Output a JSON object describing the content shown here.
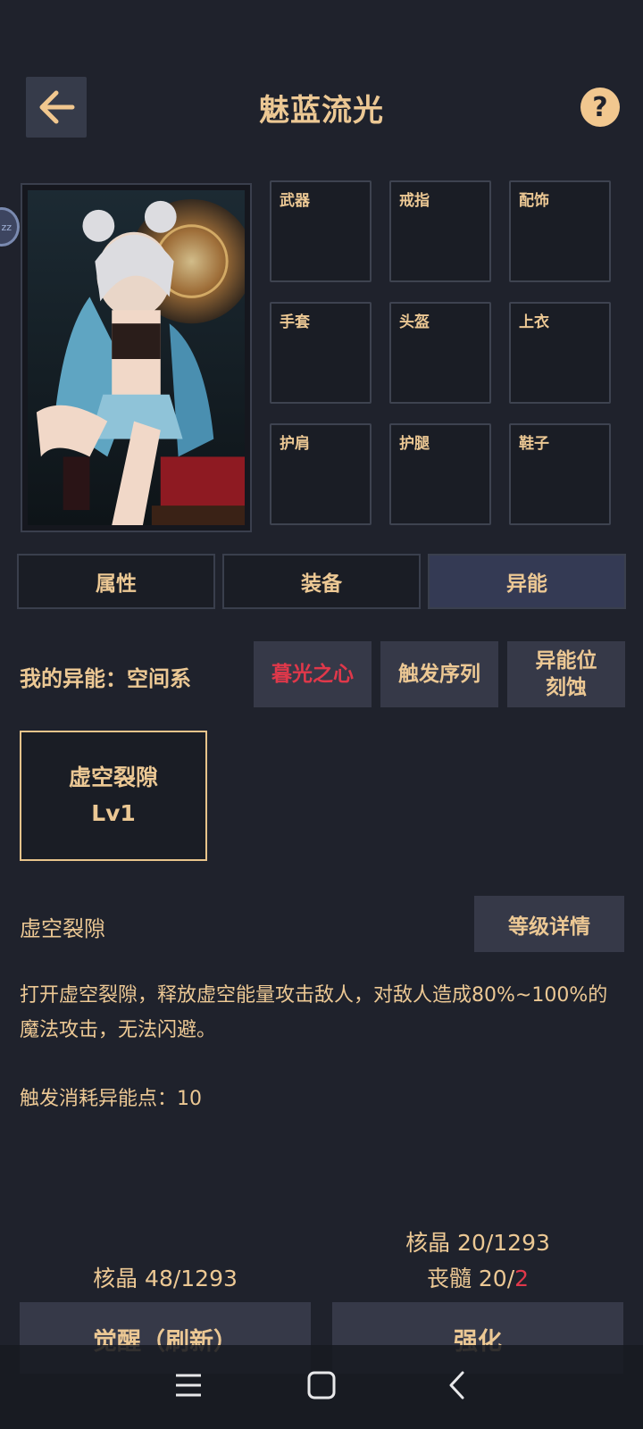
{
  "header": {
    "title": "魅蓝流光",
    "help_label": "?",
    "side_bubble_text": "zz"
  },
  "equipment": {
    "slots": [
      {
        "label": "武器"
      },
      {
        "label": "戒指"
      },
      {
        "label": "配饰"
      },
      {
        "label": "手套"
      },
      {
        "label": "头盔"
      },
      {
        "label": "上衣"
      },
      {
        "label": "护肩"
      },
      {
        "label": "护腿"
      },
      {
        "label": "鞋子"
      }
    ]
  },
  "tabs": [
    {
      "label": "属性",
      "active": false
    },
    {
      "label": "装备",
      "active": false
    },
    {
      "label": "异能",
      "active": true
    }
  ],
  "ability": {
    "my_ability_label": "我的异能：空间系",
    "buttons": [
      {
        "label": "暮光之心"
      },
      {
        "label": "触发序列"
      },
      {
        "label": "异能位\n刻蚀"
      }
    ],
    "skill_card": {
      "name": "虚空裂隙",
      "level": "Lv1"
    },
    "skill_title": "虚空裂隙",
    "level_detail_button": "等级详情",
    "description": "打开虚空裂隙，释放虚空能量攻击敌人，对敌人造成80%~100%的魔法攻击，无法闪避。",
    "trigger_cost": "触发消耗异能点：10"
  },
  "bottom": {
    "left_cost": "核晶 48/1293",
    "right_cost_line1": "核晶 20/1293",
    "right_cost_line2_prefix": "丧髓 20/",
    "right_cost_line2_value": "2",
    "awaken_button": "觉醒（刷新）",
    "enhance_button": "强化"
  },
  "colors": {
    "background": "#1f222c",
    "accent_text": "#ecc894",
    "warning_red": "#e0384a",
    "active_tab": "#343a54",
    "button_bg": "#363948"
  },
  "icons": {
    "back": "arrow-left-icon",
    "help": "question-icon",
    "nav_menu": "menu-icon",
    "nav_home": "home-square-icon",
    "nav_back": "chevron-left-icon"
  }
}
